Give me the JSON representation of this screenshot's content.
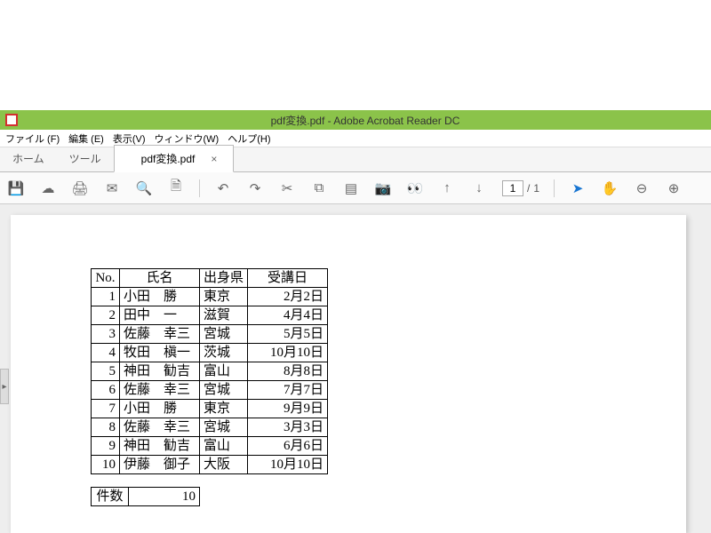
{
  "titlebar": {
    "title": "pdf変換.pdf - Adobe Acrobat Reader DC"
  },
  "menubar": {
    "file": "ファイル (F)",
    "edit": "編集 (E)",
    "view": "表示(V)",
    "window": "ウィンドウ(W)",
    "help": "ヘルプ(H)"
  },
  "tabbar": {
    "home": "ホーム",
    "tools": "ツール",
    "doc": "pdf変換.pdf",
    "close": "×"
  },
  "toolbar": {
    "page_current": "1",
    "page_sep": "/",
    "page_total": "1"
  },
  "table": {
    "headers": {
      "no": "No.",
      "name": "氏名",
      "pref": "出身県",
      "date": "受講日"
    },
    "rows": [
      {
        "no": "1",
        "name": "小田　勝",
        "pref": "東京",
        "date": "2月2日"
      },
      {
        "no": "2",
        "name": "田中　一",
        "pref": "滋賀",
        "date": "4月4日"
      },
      {
        "no": "3",
        "name": "佐藤　幸三",
        "pref": "宮城",
        "date": "5月5日"
      },
      {
        "no": "4",
        "name": "牧田　槇一",
        "pref": "茨城",
        "date": "10月10日"
      },
      {
        "no": "5",
        "name": "神田　勧吉",
        "pref": "富山",
        "date": "8月8日"
      },
      {
        "no": "6",
        "name": "佐藤　幸三",
        "pref": "宮城",
        "date": "7月7日"
      },
      {
        "no": "7",
        "name": "小田　勝",
        "pref": "東京",
        "date": "9月9日"
      },
      {
        "no": "8",
        "name": "佐藤　幸三",
        "pref": "宮城",
        "date": "3月3日"
      },
      {
        "no": "9",
        "name": "神田　勧吉",
        "pref": "富山",
        "date": "6月6日"
      },
      {
        "no": "10",
        "name": "伊藤　御子",
        "pref": "大阪",
        "date": "10月10日"
      }
    ]
  },
  "count": {
    "label": "件数",
    "value": "10"
  }
}
